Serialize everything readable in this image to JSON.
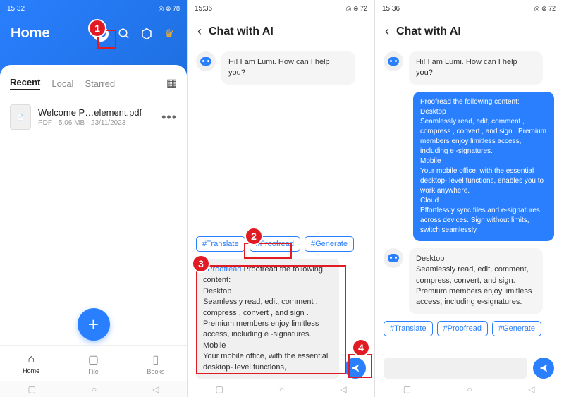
{
  "screen1": {
    "time": "15:32",
    "battery": "◎ ⊗ 78",
    "title": "Home",
    "tabs": [
      "Recent",
      "Local",
      "Starred"
    ],
    "file": {
      "name": "Welcome P…element.pdf",
      "meta": "PDF · 5.06 MB · 23/11/2023"
    },
    "nav": [
      "Home",
      "File",
      "Books"
    ]
  },
  "screen2": {
    "time": "15:36",
    "battery": "◎ ⊗ 72",
    "title": "Chat with AI",
    "greeting": "Hi! I am Lumi. How can I help you?",
    "suggestions": [
      "#Translate",
      "#Proofread",
      "#Generate"
    ],
    "input_tag": "#Proofread",
    "input_text": " Proofread the following content:\nDesktop\nSeamlessly read, edit, comment , compress , convert , and sign . Premium members enjoy limitless access, including e -signatures.\nMobile\nYour mobile office, with the essential desktop- level functions,"
  },
  "screen3": {
    "time": "15:36",
    "battery": "◎ ⊗ 72",
    "title": "Chat with AI",
    "greeting": "Hi! I am Lumi. How can I help you?",
    "user_msg": "Proofread the following content:\nDesktop\nSeamlessly read, edit, comment , compress , convert , and sign . Premium members enjoy limitless access, including e -signatures.\nMobile\nYour mobile office, with the essential desktop- level functions, enables you to work anywhere.\nCloud\nEffortlessly sync files and e-signatures across devices. Sign without limits, switch seamlessly.",
    "ai_reply": "Desktop\nSeamlessly read, edit, comment, compress, convert, and sign.\nPremium members enjoy limitless access, including e-signatures.",
    "suggestions": [
      "#Translate",
      "#Proofread",
      "#Generate"
    ]
  },
  "markers": {
    "m1": "1",
    "m2": "2",
    "m3": "3",
    "m4": "4"
  }
}
